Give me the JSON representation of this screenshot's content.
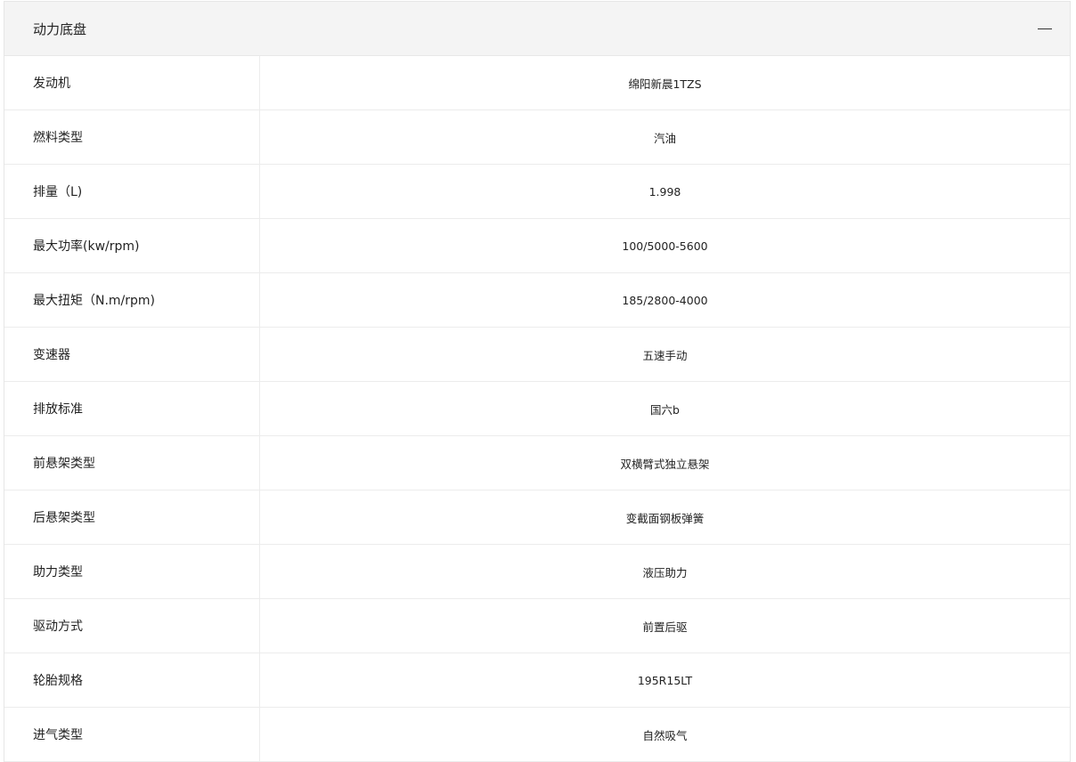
{
  "section": {
    "title": "动力底盘",
    "toggle_icon": "collapse-icon"
  },
  "specs": [
    {
      "label": "发动机",
      "value": "绵阳新晨1TZS"
    },
    {
      "label": "燃料类型",
      "value": "汽油"
    },
    {
      "label": "排量（L)",
      "value": "1.998"
    },
    {
      "label": "最大功率(kw/rpm)",
      "value": "100/5000-5600"
    },
    {
      "label": "最大扭矩（N.m/rpm)",
      "value": "185/2800-4000"
    },
    {
      "label": "变速器",
      "value": "五速手动"
    },
    {
      "label": "排放标准",
      "value": "国六b"
    },
    {
      "label": "前悬架类型",
      "value": "双横臂式独立悬架"
    },
    {
      "label": "后悬架类型",
      "value": "变截面钢板弹簧"
    },
    {
      "label": "助力类型",
      "value": "液压助力"
    },
    {
      "label": "驱动方式",
      "value": "前置后驱"
    },
    {
      "label": "轮胎规格",
      "value": "195R15LT"
    },
    {
      "label": "进气类型",
      "value": "自然吸气"
    }
  ]
}
